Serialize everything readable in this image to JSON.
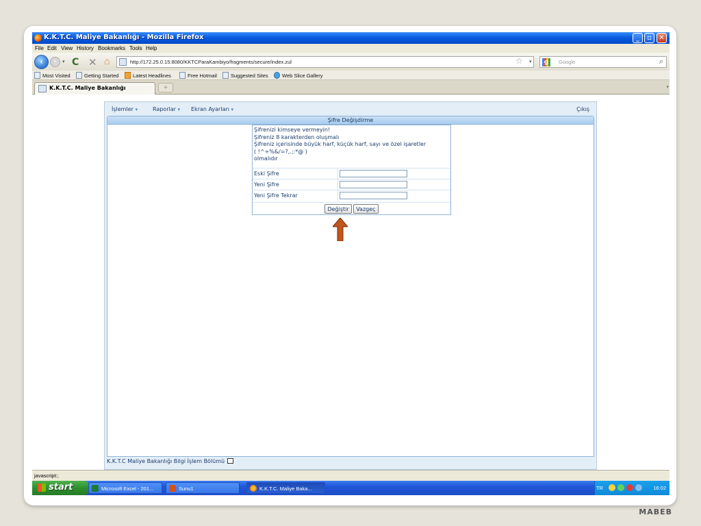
{
  "window": {
    "title": "K.K.T.C. Maliye Bakanlığı - Mozilla Firefox"
  },
  "menubar": [
    "File",
    "Edit",
    "View",
    "History",
    "Bookmarks",
    "Tools",
    "Help"
  ],
  "navbar": {
    "url": "http://172.25.0.15:8080/KKTCParaKambiyo/fragments/secure/index.zul",
    "search_placeholder": "Google"
  },
  "bookmarks": [
    "Most Visited",
    "Getting Started",
    "Latest Headlines",
    "Free Hotmail",
    "Suggested Sites",
    "Web Slice Gallery"
  ],
  "tabs": [
    {
      "label": "K.K.T.C. Maliye Bakanlığı"
    }
  ],
  "app": {
    "menu": [
      "İşlemler",
      "Raporlar",
      "Ekran Ayarları"
    ],
    "logout": "Çıkış",
    "panel_title": "Şifre Değişdirme",
    "info_lines": [
      "Şifrenizi kimseye vermeyin!",
      "Şifreniz 8 karakterden oluşmalı",
      "Şifreniz içerisinde büyük harf, küçük harf, sayı ve özel işaretler",
      "( !^+%&/=?,.;:*@ )",
      "olmalıdır"
    ],
    "fields": [
      {
        "label": "Eski Şifre",
        "value": ""
      },
      {
        "label": "Yeni Şifre",
        "value": ""
      },
      {
        "label": "Yeni Şifre Tekrar",
        "value": ""
      }
    ],
    "buttons": {
      "submit": "Değiştir",
      "cancel": "Vazgeç"
    },
    "footer": "K.K.T.C Maliye Bakanlığı Bilgi İşlem Bölümü",
    "arrow_color": "#c0561c"
  },
  "statusbar": {
    "text": "javascript:;"
  },
  "taskbar": {
    "start": "start",
    "tasks": [
      "Microsoft Excel - 201...",
      "Sunu1",
      "K.K.T.C. Maliye Baka..."
    ],
    "lang": "TR",
    "clock": "16:02"
  },
  "slide_mark": "MABEB"
}
